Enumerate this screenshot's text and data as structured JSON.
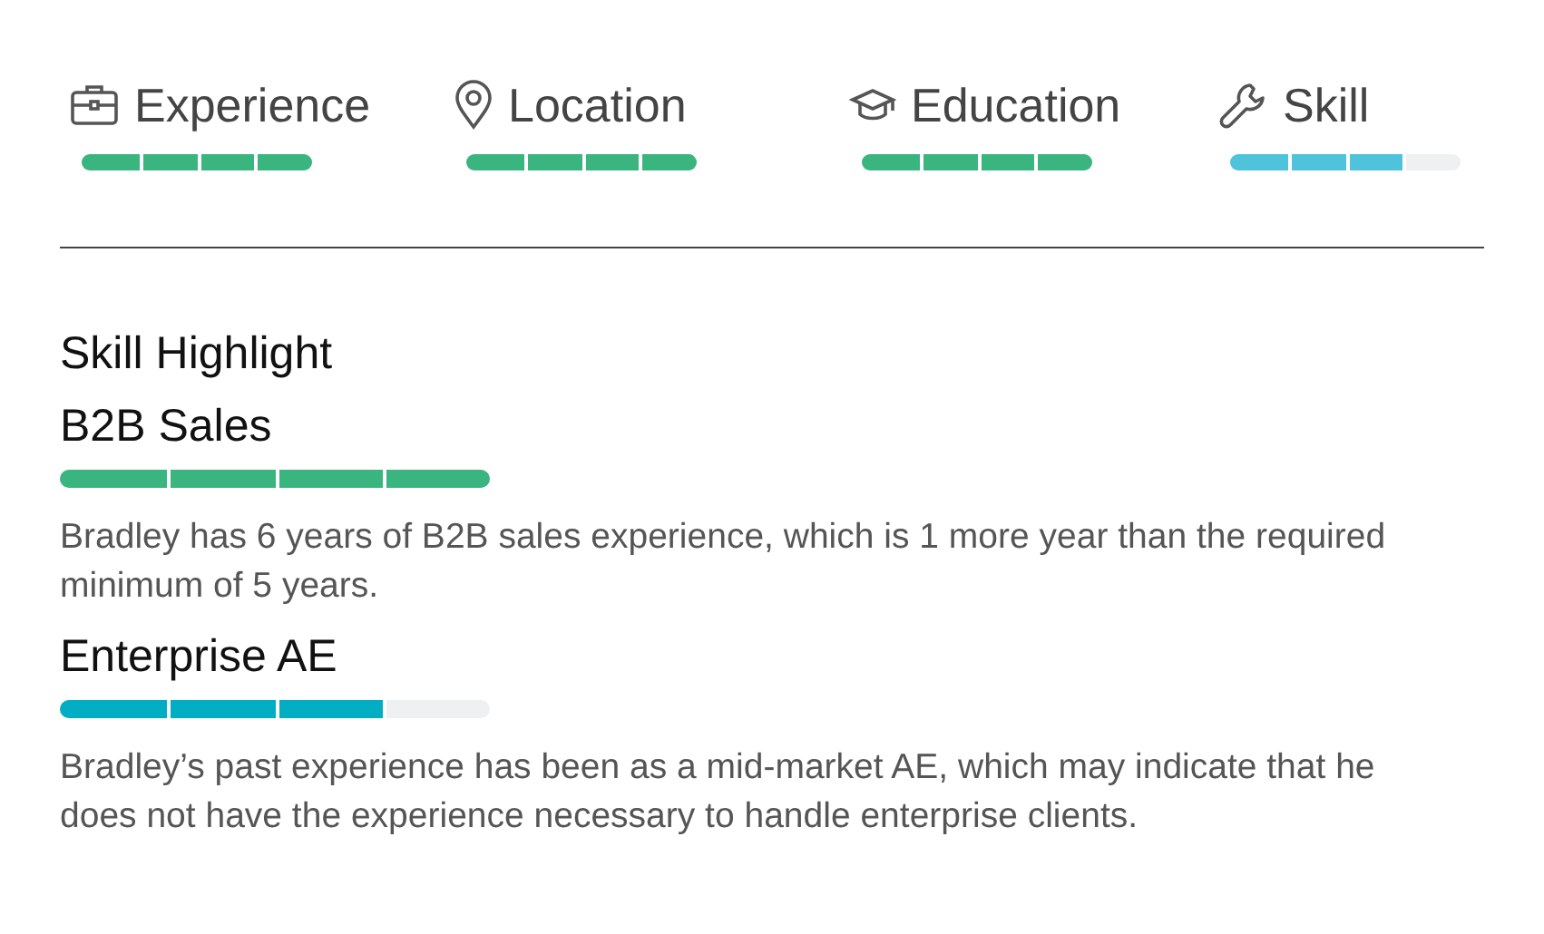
{
  "criteria": [
    {
      "kind": "briefcase",
      "label": "Experience",
      "level": 1,
      "color": "#3bb57f"
    },
    {
      "kind": "pin",
      "label": "Location",
      "level": 1,
      "color": "#3bb57f"
    },
    {
      "kind": "cap",
      "label": "Education",
      "level": 1,
      "color": "#3bb57f"
    },
    {
      "kind": "wrench",
      "label": "Skill",
      "level": 0.75,
      "color": "#4fc3dc"
    }
  ],
  "section_title": "Skill Highlight",
  "skills": [
    {
      "name": "B2B Sales",
      "level": 1,
      "color": "#3bb57f",
      "description": "Bradley has 6 years of B2B sales experience, which is 1 more year than the required minimum of 5 years."
    },
    {
      "name": "Enterprise AE",
      "level": 0.75,
      "color": "#00adc3",
      "description": "Bradley’s past experience has been as a mid-market AE, which may indicate that he does not have the experience necessary to handle enterprise clients."
    }
  ]
}
